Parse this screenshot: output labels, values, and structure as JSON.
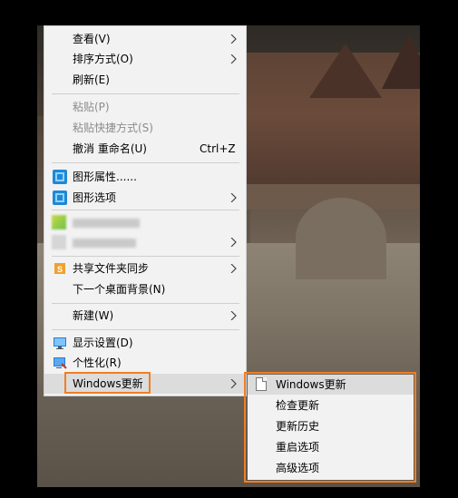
{
  "menu": {
    "items": [
      {
        "label": "查看(V)",
        "submenu": true
      },
      {
        "label": "排序方式(O)",
        "submenu": true
      },
      {
        "label": "刷新(E)"
      },
      {
        "label": "粘贴(P)",
        "disabled": true
      },
      {
        "label": "粘贴快捷方式(S)",
        "disabled": true
      },
      {
        "label": "撤消 重命名(U)",
        "accel": "Ctrl+Z"
      },
      {
        "label": "图形属性......",
        "icon": "intel-graphics-icon"
      },
      {
        "label": "图形选项",
        "icon": "intel-graphics-icon",
        "submenu": true
      },
      {
        "label": "共享文件夹同步",
        "icon": "sync-folder-icon",
        "submenu": true
      },
      {
        "label": "下一个桌面背景(N)"
      },
      {
        "label": "新建(W)",
        "submenu": true
      },
      {
        "label": "显示设置(D)",
        "icon": "display-settings-icon"
      },
      {
        "label": "个性化(R)",
        "icon": "personalize-icon"
      },
      {
        "label": "Windows更新",
        "submenu": true,
        "highlighted": true
      }
    ]
  },
  "submenu": {
    "items": [
      {
        "label": "Windows更新",
        "icon": "document-icon",
        "active": true
      },
      {
        "label": "检查更新"
      },
      {
        "label": "更新历史"
      },
      {
        "label": "重启选项"
      },
      {
        "label": "高级选项"
      }
    ]
  },
  "colors": {
    "menu_bg": "#f2f2f2",
    "highlight_box": "#f07e24",
    "hover_bg": "#dcdcdc",
    "disabled_text": "#8c8c8c"
  }
}
